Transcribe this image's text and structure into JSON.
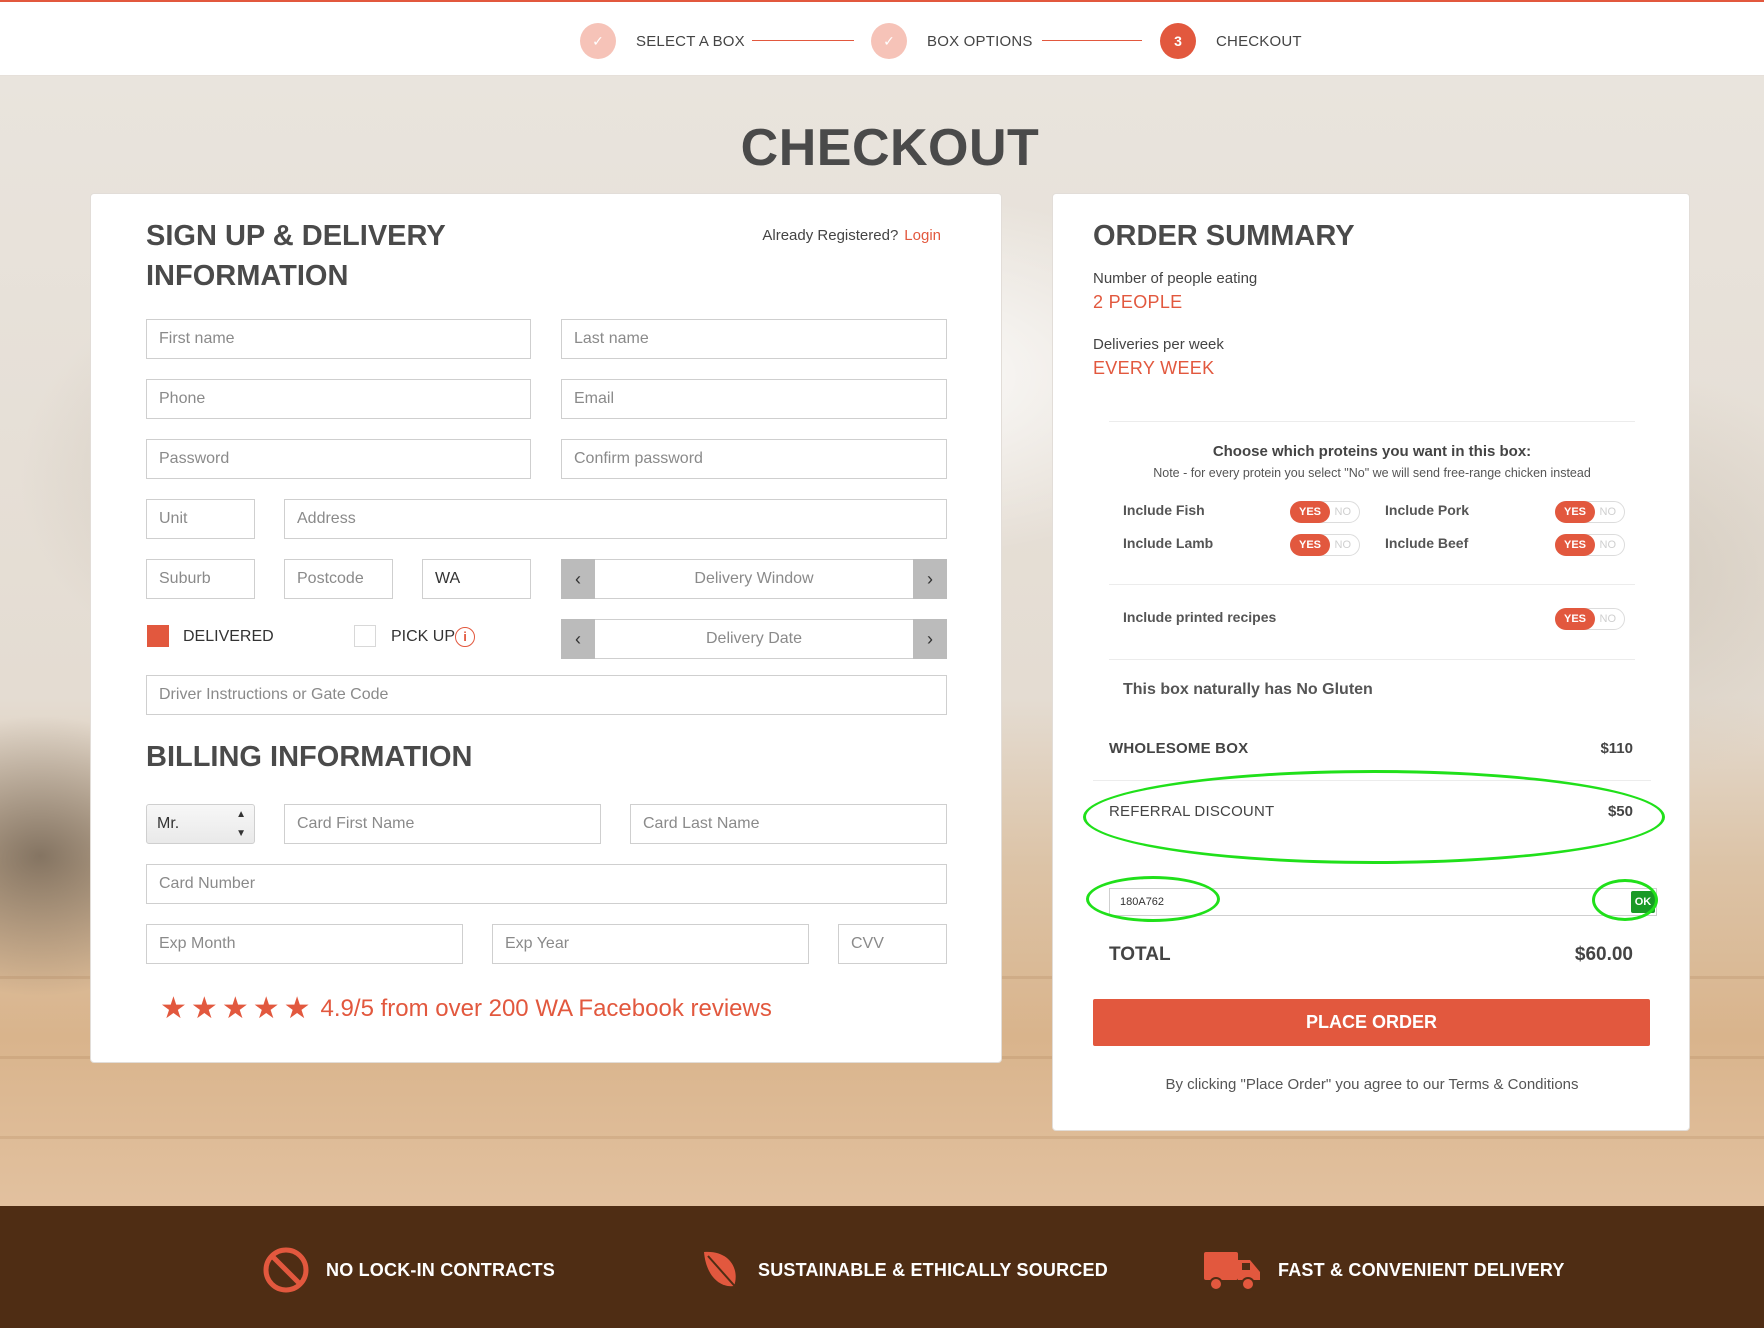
{
  "progress": {
    "steps": [
      {
        "label": "SELECT A BOX",
        "state": "done",
        "marker": "✓"
      },
      {
        "label": "BOX OPTIONS",
        "state": "done",
        "marker": "✓"
      },
      {
        "label": "CHECKOUT",
        "state": "active",
        "marker": "3"
      }
    ]
  },
  "page_title": "CHECKOUT",
  "signup": {
    "title_line1": "SIGN UP & DELIVERY",
    "title_line2": "INFORMATION",
    "already_registered": "Already Registered?",
    "login_link": "Login",
    "fields": {
      "first_name": "First name",
      "last_name": "Last name",
      "phone": "Phone",
      "email": "Email",
      "password": "Password",
      "confirm_password": "Confirm password",
      "unit": "Unit",
      "address": "Address",
      "suburb": "Suburb",
      "postcode": "Postcode",
      "state": "WA",
      "delivery_window": "Delivery Window",
      "delivery_date": "Delivery Date",
      "driver_instructions": "Driver Instructions or Gate Code"
    },
    "delivered_label": "DELIVERED",
    "pickup_label": "PICK UP",
    "delivered_checked": true,
    "pickup_checked": false
  },
  "billing": {
    "title": "BILLING INFORMATION",
    "title_select": "Mr.",
    "card_first_name": "Card First Name",
    "card_last_name": "Card Last Name",
    "card_number": "Card Number",
    "exp_month": "Exp Month",
    "exp_year": "Exp Year",
    "cvv": "CVV"
  },
  "reviews": {
    "stars": 5,
    "text": "4.9/5 from over 200 WA Facebook reviews"
  },
  "summary": {
    "title": "ORDER SUMMARY",
    "people_label": "Number of people eating",
    "people_value": "2 PEOPLE",
    "deliveries_label": "Deliveries per week",
    "deliveries_value": "EVERY WEEK",
    "proteins_title": "Choose which proteins you want in this box:",
    "proteins_note": "Note - for every protein you select \"No\" we will send free-range chicken instead",
    "options": {
      "fish": "Include Fish",
      "pork": "Include Pork",
      "lamb": "Include Lamb",
      "beef": "Include Beef",
      "recipes": "Include printed recipes"
    },
    "toggle_yes": "YES",
    "toggle_no": "NO",
    "gluten_note": "This box naturally has No Gluten",
    "box_label": "WHOLESOME BOX",
    "box_price": "$110",
    "discount_label": "REFERRAL DISCOUNT",
    "discount_amount": "$50",
    "promo_code": "180A762",
    "ok_label": "OK",
    "total_label": "TOTAL",
    "total_amount": "$60.00",
    "place_order": "PLACE ORDER",
    "terms": "By clicking \"Place Order\" you agree to our Terms & Conditions"
  },
  "footer": {
    "items": [
      {
        "label": "NO LOCK-IN CONTRACTS",
        "icon": "no-entry-icon"
      },
      {
        "label": "SUSTAINABLE & ETHICALLY SOURCED",
        "icon": "leaf-icon"
      },
      {
        "label": "FAST & CONVENIENT DELIVERY",
        "icon": "truck-icon"
      }
    ]
  },
  "colors": {
    "accent": "#e2583e",
    "footer_bg": "#4f2d14",
    "highlight": "#20e01a",
    "ok_button": "#1a9a26"
  }
}
